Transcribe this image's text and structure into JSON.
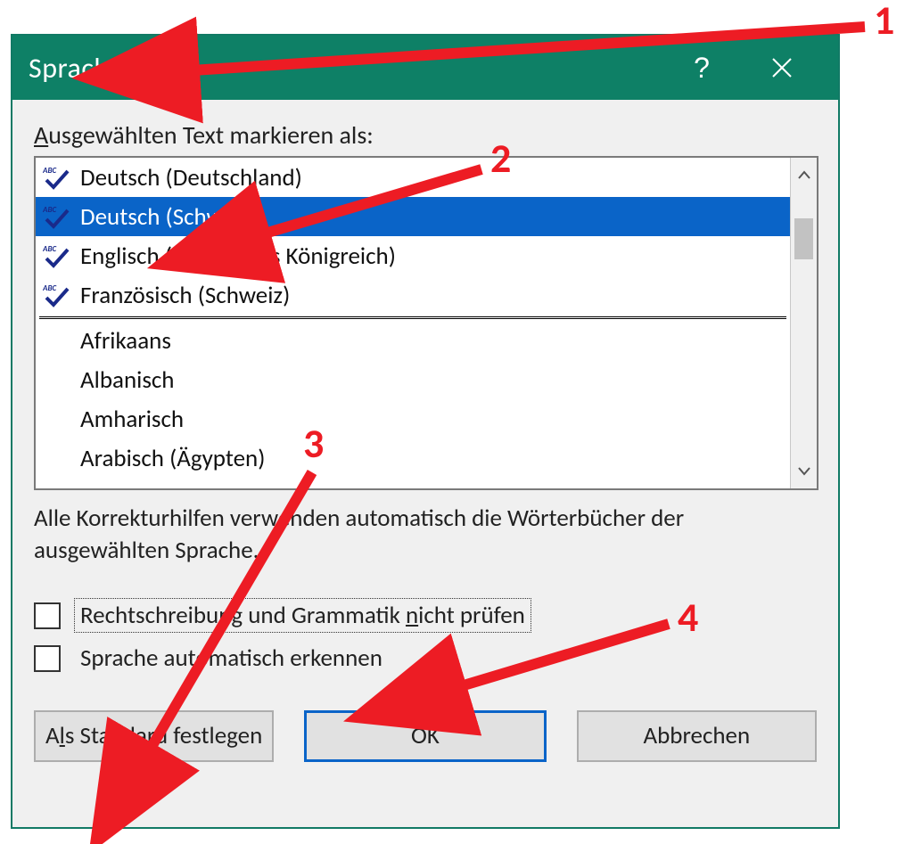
{
  "annotations": {
    "n1": "1",
    "n2": "2",
    "n3": "3",
    "n4": "4"
  },
  "titlebar": {
    "title": "Sprache",
    "help_symbol": "?",
    "close_label": "Schließen"
  },
  "list_label_pre": "A",
  "list_label_rest": "usgewählten Text markieren als:",
  "languages_proofing": [
    {
      "name": "Deutsch (Deutschland)",
      "selected": false
    },
    {
      "name": "Deutsch (Schweiz)",
      "selected": true
    },
    {
      "name": "Englisch (Vereinigtes Königreich)",
      "selected": false
    },
    {
      "name": "Französisch (Schweiz)",
      "selected": false
    }
  ],
  "languages_other": [
    {
      "name": "Afrikaans"
    },
    {
      "name": "Albanisch"
    },
    {
      "name": "Amharisch"
    },
    {
      "name": "Arabisch (Ägypten)"
    }
  ],
  "description": "Alle Korrekturhilfen verwenden automatisch die Wörterbücher der ausgewählten Sprache.",
  "checkbox1_pre": "Rechtschreibung und Grammatik ",
  "checkbox1_accel": "n",
  "checkbox1_post": "icht prüfen",
  "checkbox2_label": "Sprache automatisch erkennen",
  "buttons": {
    "set_default_pre": "A",
    "set_default_accel": "l",
    "set_default_post": "s Standard festlegen",
    "ok": "OK",
    "cancel": "Abbrechen"
  }
}
